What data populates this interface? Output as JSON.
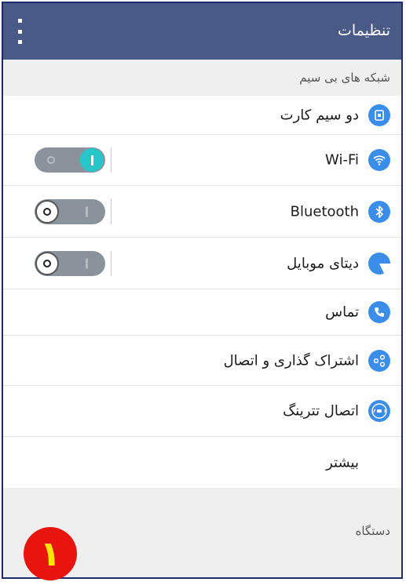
{
  "appbar": {
    "title": "تنظیمات",
    "menu_icon": "overflow-menu-icon"
  },
  "sections": {
    "wireless": "شبکه های بی سیم",
    "device": "دستگاه"
  },
  "items": [
    {
      "label": "دو سیم کارت",
      "icon": "dual-sim-icon"
    },
    {
      "label": "Wi-Fi",
      "icon": "wifi-icon",
      "toggle": "on"
    },
    {
      "label": "Bluetooth",
      "icon": "bluetooth-icon",
      "toggle": "off"
    },
    {
      "label": "دیتای موبایل",
      "icon": "mobile-data-icon",
      "toggle": "off"
    },
    {
      "label": "تماس",
      "icon": "phone-icon"
    },
    {
      "label": "اشتراک گذاری و اتصال",
      "icon": "share-connect-icon"
    },
    {
      "label": "اتصال تترینگ",
      "icon": "tethering-icon"
    },
    {
      "label": "بیشتر"
    }
  ],
  "badge": {
    "text": "۱"
  },
  "colors": {
    "appbar": "#4a5a87",
    "accent": "#3b8dea",
    "toggle_on": "#26c6c9",
    "badge": "#e8140e"
  }
}
